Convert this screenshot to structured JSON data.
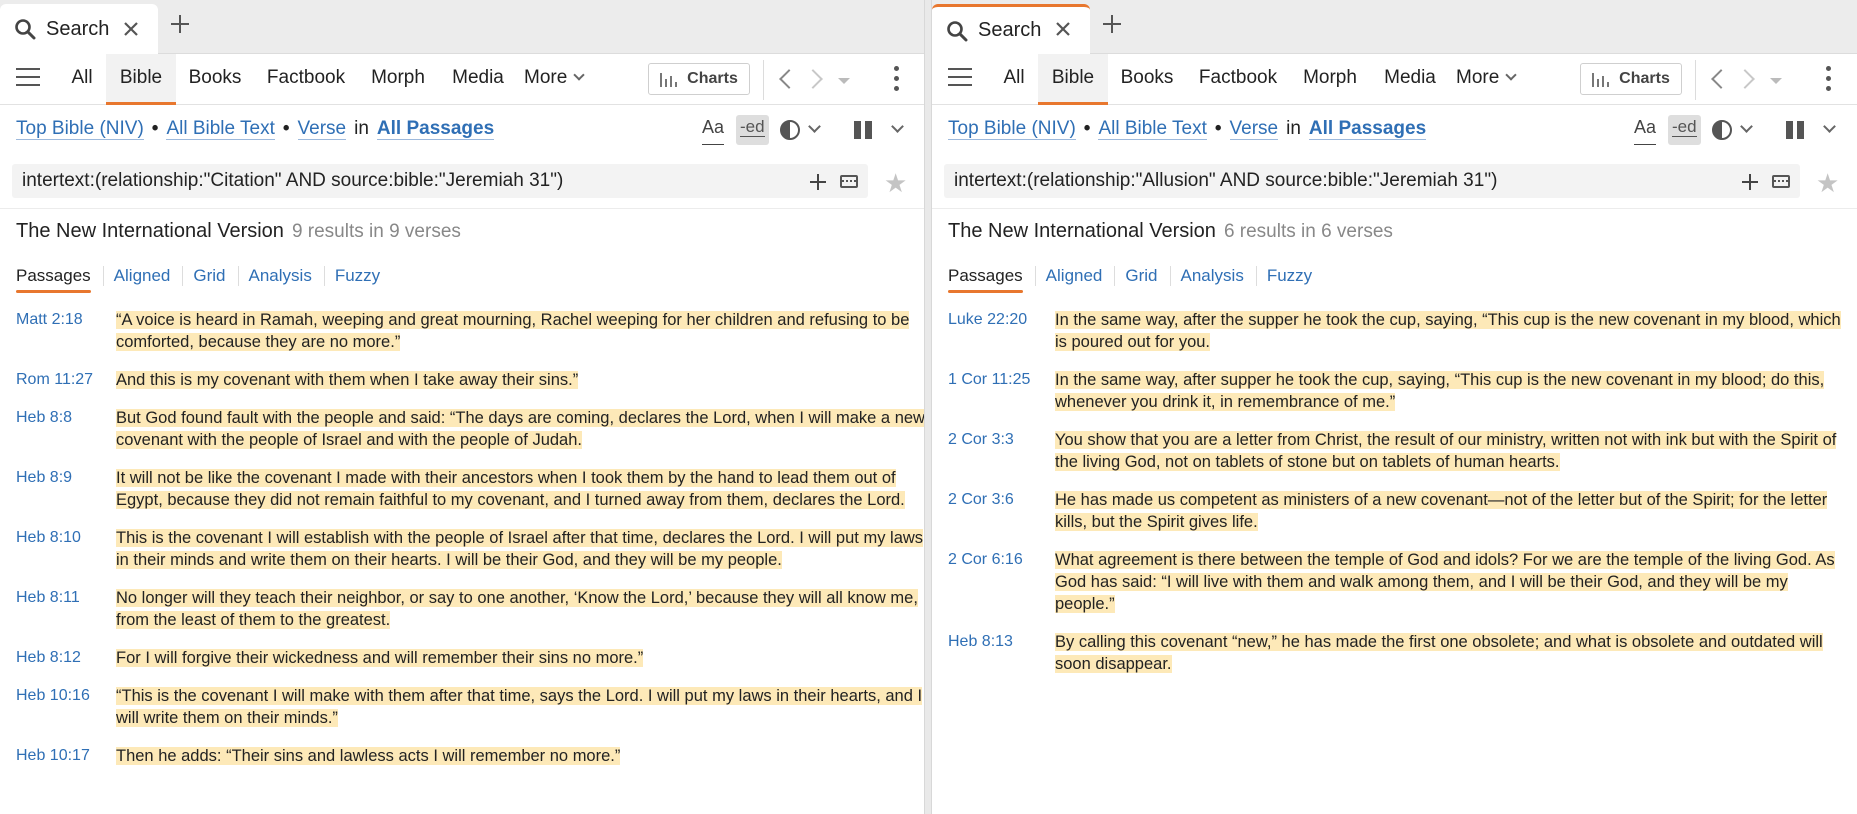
{
  "left": {
    "tab": {
      "label": "Search"
    },
    "nav": {
      "items": [
        "All",
        "Bible",
        "Books",
        "Factbook",
        "Morph",
        "Media"
      ],
      "more": "More",
      "charts": "Charts"
    },
    "scope": {
      "resource": "Top Bible (NIV)",
      "range": "All Bible Text",
      "unit": "Verse",
      "in": "in",
      "passages": "All Passages",
      "aa": "Aa",
      "ed": "-ed"
    },
    "query": "intertext:(relationship:\"Citation\" AND source:bible:\"Jeremiah 31\")",
    "result_title": "The New International Version",
    "result_count": "9 results in 9 verses",
    "subtabs": [
      "Passages",
      "Aligned",
      "Grid",
      "Analysis",
      "Fuzzy"
    ],
    "results": [
      {
        "ref": "Matt 2:18",
        "text": "“A voice is heard in Ramah, weeping and great mourning, Rachel weeping for her children and refusing to be comforted, because they are no more.”"
      },
      {
        "ref": "Rom 11:27",
        "text": "And this is my covenant with them when I take away their sins.”"
      },
      {
        "ref": "Heb 8:8",
        "text": "But God found fault with the people and said: “The days are coming, declares the Lord, when I will make a new covenant with the people of Israel and with the people of Judah."
      },
      {
        "ref": "Heb 8:9",
        "text": "It will not be like the covenant I made with their ancestors when I took them by the hand to lead them out of Egypt, because they did not remain faithful to my covenant, and I turned away from them, declares the Lord."
      },
      {
        "ref": "Heb 8:10",
        "text": "This is the covenant I will establish with the people of Israel after that time, declares the Lord. I will put my laws in their minds and write them on their hearts. I will be their God, and they will be my people."
      },
      {
        "ref": "Heb 8:11",
        "text": "No longer will they teach their neighbor, or say to one another, ‘Know the Lord,’ because they will all know me, from the least of them to the greatest."
      },
      {
        "ref": "Heb 8:12",
        "text": "For I will forgive their wickedness and will remember their sins no more.”"
      },
      {
        "ref": "Heb 10:16",
        "text": "“This is the covenant I will make with them after that time, says the Lord. I will put my laws in their hearts, and I will write them on their minds.”"
      },
      {
        "ref": "Heb 10:17",
        "text": "Then he adds: “Their sins and lawless acts I will remember no more.”"
      }
    ]
  },
  "right": {
    "tab": {
      "label": "Search"
    },
    "nav": {
      "items": [
        "All",
        "Bible",
        "Books",
        "Factbook",
        "Morph",
        "Media"
      ],
      "more": "More",
      "charts": "Charts"
    },
    "scope": {
      "resource": "Top Bible (NIV)",
      "range": "All Bible Text",
      "unit": "Verse",
      "in": "in",
      "passages": "All Passages",
      "aa": "Aa",
      "ed": "-ed"
    },
    "query": "intertext:(relationship:\"Allusion\" AND source:bible:\"Jeremiah 31\")",
    "result_title": "The New International Version",
    "result_count": "6 results in 6 verses",
    "subtabs": [
      "Passages",
      "Aligned",
      "Grid",
      "Analysis",
      "Fuzzy"
    ],
    "results": [
      {
        "ref": "Luke 22:20",
        "text": "In the same way, after the supper he took the cup, saying, “This cup is the new covenant in my blood, which is poured out for you."
      },
      {
        "ref": "1 Cor 11:25",
        "text": "In the same way, after supper he took the cup, saying, “This cup is the new covenant in my blood; do this, whenever you drink it, in remembrance of me.”"
      },
      {
        "ref": "2 Cor 3:3",
        "text": "You show that you are a letter from Christ, the result of our ministry, written not with ink but with the Spirit of the living God, not on tablets of stone but on tablets of human hearts."
      },
      {
        "ref": "2 Cor 3:6",
        "text": "He has made us competent as ministers of a new covenant—not of the letter but of the Spirit; for the letter kills, but the Spirit gives life."
      },
      {
        "ref": "2 Cor 6:16",
        "text": "What agreement is there between the temple of God and idols? For we are the temple of the living God. As God has said: “I will live with them and walk among them, and I will be their God, and they will be my people.”"
      },
      {
        "ref": "Heb 8:13",
        "text": "By calling this covenant “new,” he has made the first one obsolete; and what is obsolete and outdated will soon disappear."
      }
    ]
  },
  "colors": {
    "accent": "#e8772e",
    "link": "#2f6fb5",
    "highlight": "#fde9b8"
  },
  "icons": [
    "search-icon",
    "close-icon",
    "plus-icon",
    "hamburger-icon",
    "chevron-down-icon",
    "charts-icon",
    "back-arrow-icon",
    "forward-arrow-icon",
    "history-dropdown-icon",
    "kebab-menu-icon",
    "visual-filter-icon",
    "parallel-panes-icon",
    "keyboard-icon",
    "star-icon"
  ]
}
